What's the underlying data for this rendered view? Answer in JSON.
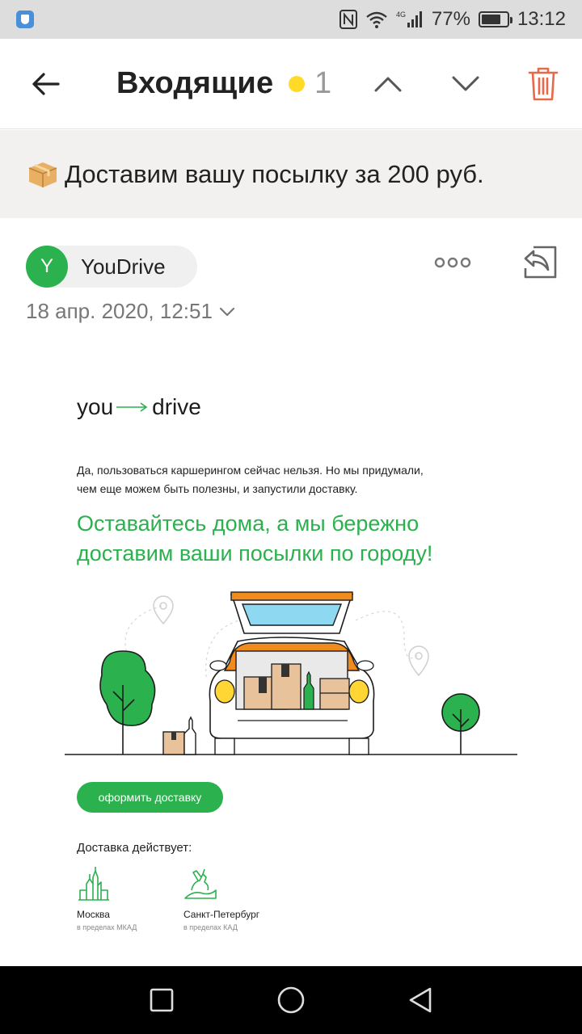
{
  "status_bar": {
    "network": "4G",
    "battery_percent": "77%",
    "battery_level": 0.77,
    "time": "13:12"
  },
  "app_bar": {
    "title": "Входящие",
    "unread_count": "1",
    "accent_dot_color": "#ffdb28",
    "delete_icon_color": "#e8694a"
  },
  "subject": {
    "icon": "package-icon",
    "text": "Доставим вашу посылку за 200 руб."
  },
  "sender": {
    "avatar_letter": "Y",
    "avatar_color": "#2bb14e",
    "name": "YouDrive",
    "date": "18 апр. 2020, 12:51"
  },
  "email": {
    "logo_left": "you",
    "logo_right": "drive",
    "intro_line1": "Да, пользоваться каршерингом сейчас нельзя. Но мы придумали,",
    "intro_line2": "чем еще можем быть полезны, и запустили доставку.",
    "headline_line1": "Оставайтесь дома, а мы бережно",
    "headline_line2": "доставим ваши посылки по городу!",
    "cta_label": "оформить доставку",
    "delivery_label": "Доставка действует:",
    "cities": [
      {
        "name": "Москва",
        "sub": "в пределах МКАД"
      },
      {
        "name": "Санкт-Петербург",
        "sub": "в пределах КАД"
      }
    ],
    "brand_color": "#2bb14e"
  },
  "nav_bar": {
    "buttons": [
      "recents-square-icon",
      "home-circle-icon",
      "back-triangle-icon"
    ]
  }
}
